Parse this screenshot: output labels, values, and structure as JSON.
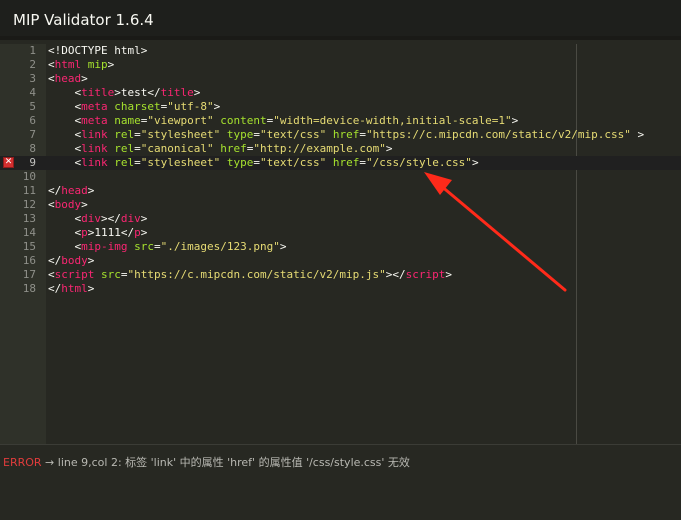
{
  "app": {
    "title": "MIP Validator 1.6.4"
  },
  "editor": {
    "active_line": 9,
    "error_line": 9,
    "lines": [
      {
        "n": "1",
        "tokens": [
          [
            "punct",
            "<!DOCTYPE html>"
          ]
        ]
      },
      {
        "n": "2",
        "tokens": [
          [
            "punct",
            "<"
          ],
          [
            "tag",
            "html"
          ],
          [
            "punct",
            " "
          ],
          [
            "attr",
            "mip"
          ],
          [
            "punct",
            ">"
          ]
        ]
      },
      {
        "n": "3",
        "tokens": [
          [
            "punct",
            "<"
          ],
          [
            "tag",
            "head"
          ],
          [
            "punct",
            ">"
          ]
        ]
      },
      {
        "n": "4",
        "tokens": [
          [
            "punct",
            "    <"
          ],
          [
            "tag",
            "title"
          ],
          [
            "punct",
            ">test</"
          ],
          [
            "tag",
            "title"
          ],
          [
            "punct",
            ">"
          ]
        ]
      },
      {
        "n": "5",
        "tokens": [
          [
            "punct",
            "    <"
          ],
          [
            "tag",
            "meta"
          ],
          [
            "punct",
            " "
          ],
          [
            "attr",
            "charset"
          ],
          [
            "punct",
            "="
          ],
          [
            "str",
            "\"utf-8\""
          ],
          [
            "punct",
            ">"
          ]
        ]
      },
      {
        "n": "6",
        "tokens": [
          [
            "punct",
            "    <"
          ],
          [
            "tag",
            "meta"
          ],
          [
            "punct",
            " "
          ],
          [
            "attr",
            "name"
          ],
          [
            "punct",
            "="
          ],
          [
            "str",
            "\"viewport\""
          ],
          [
            "punct",
            " "
          ],
          [
            "attr",
            "content"
          ],
          [
            "punct",
            "="
          ],
          [
            "str",
            "\"width=device-width,initial-scale=1\""
          ],
          [
            "punct",
            ">"
          ]
        ]
      },
      {
        "n": "7",
        "tokens": [
          [
            "punct",
            "    <"
          ],
          [
            "tag",
            "link"
          ],
          [
            "punct",
            " "
          ],
          [
            "attr",
            "rel"
          ],
          [
            "punct",
            "="
          ],
          [
            "str",
            "\"stylesheet\""
          ],
          [
            "punct",
            " "
          ],
          [
            "attr",
            "type"
          ],
          [
            "punct",
            "="
          ],
          [
            "str",
            "\"text/css\""
          ],
          [
            "punct",
            " "
          ],
          [
            "attr",
            "href"
          ],
          [
            "punct",
            "="
          ],
          [
            "str",
            "\"https://c.mipcdn.com/static/v2/mip.css\""
          ],
          [
            "punct",
            " >"
          ]
        ]
      },
      {
        "n": "8",
        "tokens": [
          [
            "punct",
            "    <"
          ],
          [
            "tag",
            "link"
          ],
          [
            "punct",
            " "
          ],
          [
            "attr",
            "rel"
          ],
          [
            "punct",
            "="
          ],
          [
            "str",
            "\"canonical\""
          ],
          [
            "punct",
            " "
          ],
          [
            "attr",
            "href"
          ],
          [
            "punct",
            "="
          ],
          [
            "str",
            "\"http://example.com\""
          ],
          [
            "punct",
            ">"
          ]
        ]
      },
      {
        "n": "9",
        "tokens": [
          [
            "punct",
            "    <"
          ],
          [
            "tag",
            "link"
          ],
          [
            "punct",
            " "
          ],
          [
            "attr",
            "rel"
          ],
          [
            "punct",
            "="
          ],
          [
            "str",
            "\"stylesheet\""
          ],
          [
            "punct",
            " "
          ],
          [
            "attr",
            "type"
          ],
          [
            "punct",
            "="
          ],
          [
            "str",
            "\"text/css\""
          ],
          [
            "punct",
            " "
          ],
          [
            "attr",
            "href"
          ],
          [
            "punct",
            "="
          ],
          [
            "str",
            "\"/css/style.css\""
          ],
          [
            "punct",
            ">"
          ]
        ]
      },
      {
        "n": "10",
        "tokens": []
      },
      {
        "n": "11",
        "tokens": [
          [
            "punct",
            "</"
          ],
          [
            "tag",
            "head"
          ],
          [
            "punct",
            ">"
          ]
        ]
      },
      {
        "n": "12",
        "tokens": [
          [
            "punct",
            "<"
          ],
          [
            "tag",
            "body"
          ],
          [
            "punct",
            ">"
          ]
        ]
      },
      {
        "n": "13",
        "tokens": [
          [
            "punct",
            "    <"
          ],
          [
            "tag",
            "div"
          ],
          [
            "punct",
            "></"
          ],
          [
            "tag",
            "div"
          ],
          [
            "punct",
            ">"
          ]
        ]
      },
      {
        "n": "14",
        "tokens": [
          [
            "punct",
            "    <"
          ],
          [
            "tag",
            "p"
          ],
          [
            "punct",
            ">1111</"
          ],
          [
            "tag",
            "p"
          ],
          [
            "punct",
            ">"
          ]
        ]
      },
      {
        "n": "15",
        "tokens": [
          [
            "punct",
            "    <"
          ],
          [
            "tag",
            "mip-img"
          ],
          [
            "punct",
            " "
          ],
          [
            "attr",
            "src"
          ],
          [
            "punct",
            "="
          ],
          [
            "str",
            "\"./images/123.png\""
          ],
          [
            "punct",
            ">"
          ]
        ]
      },
      {
        "n": "16",
        "tokens": [
          [
            "punct",
            "</"
          ],
          [
            "tag",
            "body"
          ],
          [
            "punct",
            ">"
          ]
        ]
      },
      {
        "n": "17",
        "tokens": [
          [
            "punct",
            "<"
          ],
          [
            "tag",
            "script"
          ],
          [
            "punct",
            " "
          ],
          [
            "attr",
            "src"
          ],
          [
            "punct",
            "="
          ],
          [
            "str",
            "\"https://c.mipcdn.com/static/v2/mip.js\""
          ],
          [
            "punct",
            "></"
          ],
          [
            "tag",
            "script"
          ],
          [
            "punct",
            ">"
          ]
        ]
      },
      {
        "n": "18",
        "tokens": [
          [
            "punct",
            "</"
          ],
          [
            "tag",
            "html"
          ],
          [
            "punct",
            ">"
          ]
        ]
      }
    ]
  },
  "status": {
    "level": "ERROR",
    "arrow": "→",
    "message": "line 9,col 2: 标签 'link' 中的属性 'href' 的属性值 '/css/style.css' 无效"
  },
  "colors": {
    "tag": "#f92672",
    "attribute": "#a6e22e",
    "string": "#e6db74",
    "error": "#e03c3c",
    "annotation_arrow": "#ff2a1a"
  }
}
